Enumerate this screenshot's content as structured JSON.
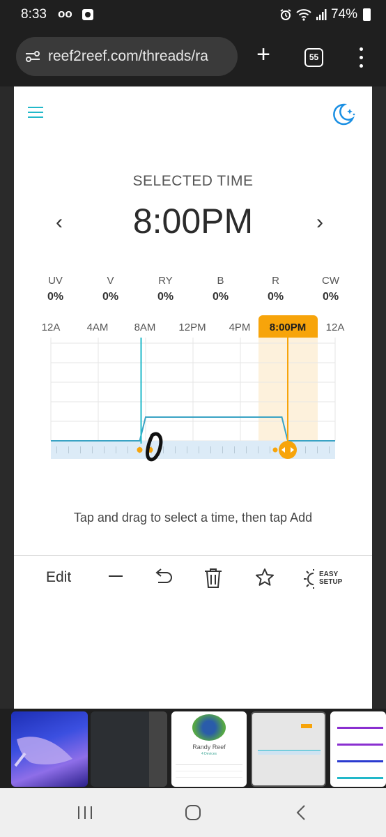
{
  "status_bar": {
    "time": "8:33",
    "voicemail": "oo",
    "battery": "74%"
  },
  "browser": {
    "url": "reef2reef.com/threads/ra",
    "tab_count": "55"
  },
  "app": {
    "selected_label": "SELECTED TIME",
    "selected_time": "8:00PM",
    "prev_symbol": "‹",
    "next_symbol": "›",
    "channels": [
      {
        "name": "UV",
        "value": "0%"
      },
      {
        "name": "V",
        "value": "0%"
      },
      {
        "name": "RY",
        "value": "0%"
      },
      {
        "name": "B",
        "value": "0%"
      },
      {
        "name": "R",
        "value": "0%"
      },
      {
        "name": "CW",
        "value": "0%"
      }
    ],
    "hours": [
      "12A",
      "4AM",
      "8AM",
      "12PM",
      "4PM",
      "8:00PM",
      "12A"
    ],
    "hint": "Tap and drag to select a time, then tap Add",
    "toolbar": {
      "edit": "Edit",
      "easy_line1": "EASY",
      "easy_line2": "SETUP"
    }
  },
  "schedule": {
    "unit": "hour of day",
    "lights_on_start": 7.5,
    "ramp_up_end": 8,
    "ramp_down_start": 19.5,
    "lights_off": 20,
    "selected_hour": 20,
    "handle_hour": 7.5
  },
  "recent_apps": {
    "randy_title": "Randy Reef",
    "randy_sub": "4 Devices"
  },
  "colors": {
    "accent": "#f7a40a",
    "teal": "#22b8c9",
    "moon": "#1a8fe3"
  }
}
